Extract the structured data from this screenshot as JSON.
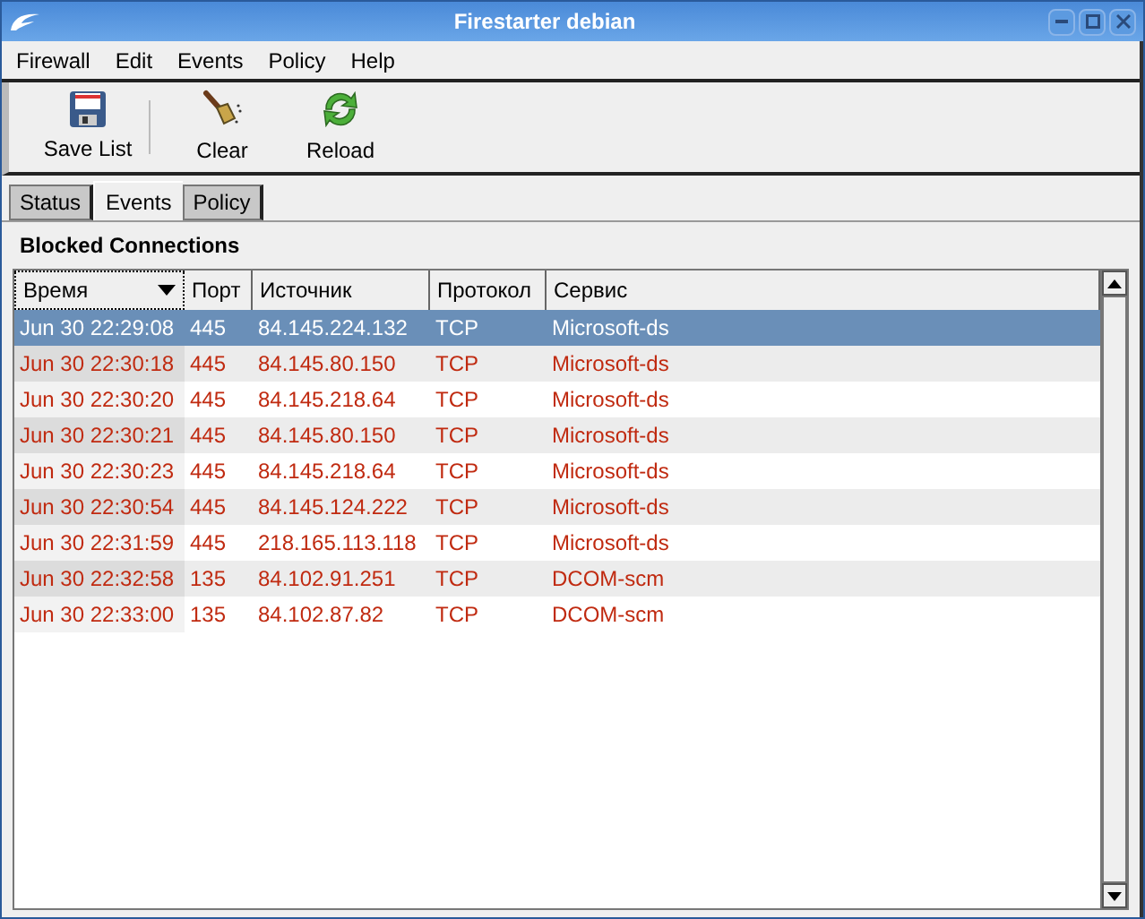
{
  "window": {
    "title": "Firestarter debian"
  },
  "menu": [
    "Firewall",
    "Edit",
    "Events",
    "Policy",
    "Help"
  ],
  "toolbar": [
    {
      "label": "Save List",
      "kind": "save"
    },
    {
      "label": "Clear",
      "kind": "clear"
    },
    {
      "label": "Reload",
      "kind": "reload"
    }
  ],
  "tabs": [
    {
      "label": "Status",
      "selected": false
    },
    {
      "label": "Events",
      "selected": true
    },
    {
      "label": "Policy",
      "selected": false
    }
  ],
  "section_title": "Blocked Connections",
  "table": {
    "columns": [
      "Время",
      "Порт",
      "Источник",
      "Протокол",
      "Сервис"
    ],
    "rows": [
      {
        "selected": true,
        "cells": [
          "Jun 30 22:29:08",
          "445",
          "84.145.224.132",
          "TCP",
          "Microsoft-ds"
        ]
      },
      {
        "selected": false,
        "cells": [
          "Jun 30 22:30:18",
          "445",
          "84.145.80.150",
          "TCP",
          "Microsoft-ds"
        ]
      },
      {
        "selected": false,
        "cells": [
          "Jun 30 22:30:20",
          "445",
          "84.145.218.64",
          "TCP",
          "Microsoft-ds"
        ]
      },
      {
        "selected": false,
        "cells": [
          "Jun 30 22:30:21",
          "445",
          "84.145.80.150",
          "TCP",
          "Microsoft-ds"
        ]
      },
      {
        "selected": false,
        "cells": [
          "Jun 30 22:30:23",
          "445",
          "84.145.218.64",
          "TCP",
          "Microsoft-ds"
        ]
      },
      {
        "selected": false,
        "cells": [
          "Jun 30 22:30:54",
          "445",
          "84.145.124.222",
          "TCP",
          "Microsoft-ds"
        ]
      },
      {
        "selected": false,
        "cells": [
          "Jun 30 22:31:59",
          "445",
          "218.165.113.118",
          "TCP",
          "Microsoft-ds"
        ]
      },
      {
        "selected": false,
        "cells": [
          "Jun 30 22:32:58",
          "135",
          "84.102.91.251",
          "TCP",
          "DCOM-scm"
        ]
      },
      {
        "selected": false,
        "cells": [
          "Jun 30 22:33:00",
          "135",
          "84.102.87.82",
          "TCP",
          "DCOM-scm"
        ]
      }
    ]
  }
}
